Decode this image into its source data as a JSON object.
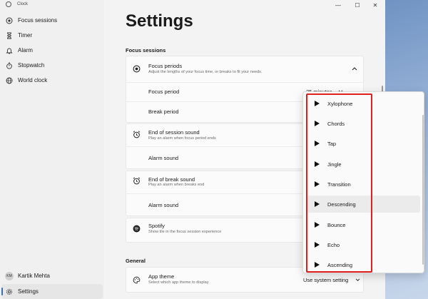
{
  "window": {
    "app_title": "Clock"
  },
  "sidebar": {
    "items": [
      {
        "label": "Focus sessions",
        "icon": "focus-icon"
      },
      {
        "label": "Timer",
        "icon": "hourglass-icon"
      },
      {
        "label": "Alarm",
        "icon": "bell-icon"
      },
      {
        "label": "Stopwatch",
        "icon": "stopwatch-icon"
      },
      {
        "label": "World clock",
        "icon": "globe-icon"
      }
    ],
    "account": {
      "initials": "KM",
      "name": "Kartik Mehta"
    },
    "settings_label": "Settings"
  },
  "titlebar": {
    "minimize": "—",
    "maximize": "☐",
    "close": "✕"
  },
  "main": {
    "title": "Settings",
    "focus_sessions": {
      "heading": "Focus sessions",
      "focus_periods": {
        "title": "Focus periods",
        "desc": "Adjust the lengths of your focus time, or breaks to fit your needs."
      },
      "focus_period": {
        "label": "Focus period",
        "value": "25 minutes"
      },
      "break_period": {
        "label": "Break period"
      },
      "end_session_sound": {
        "title": "End of session sound",
        "desc": "Play an alarm when focus period ends"
      },
      "alarm_sound_1": {
        "label": "Alarm sound"
      },
      "end_break_sound": {
        "title": "End of break sound",
        "desc": "Play an alarm when breaks end"
      },
      "alarm_sound_2": {
        "label": "Alarm sound"
      },
      "spotify": {
        "title": "Spotify",
        "desc": "Show tile in the focus session experience"
      }
    },
    "general": {
      "heading": "General",
      "app_theme": {
        "title": "App theme",
        "desc": "Select which app theme to display",
        "value": "Use system setting"
      }
    }
  },
  "dropdown": {
    "options": [
      "Xylophone",
      "Chords",
      "Tap",
      "Jingle",
      "Transition",
      "Descending",
      "Bounce",
      "Echo",
      "Ascending"
    ],
    "hovered": "Descending"
  },
  "colors": {
    "accent": "#3b6fb5",
    "highlight_box": "#e0201f"
  }
}
